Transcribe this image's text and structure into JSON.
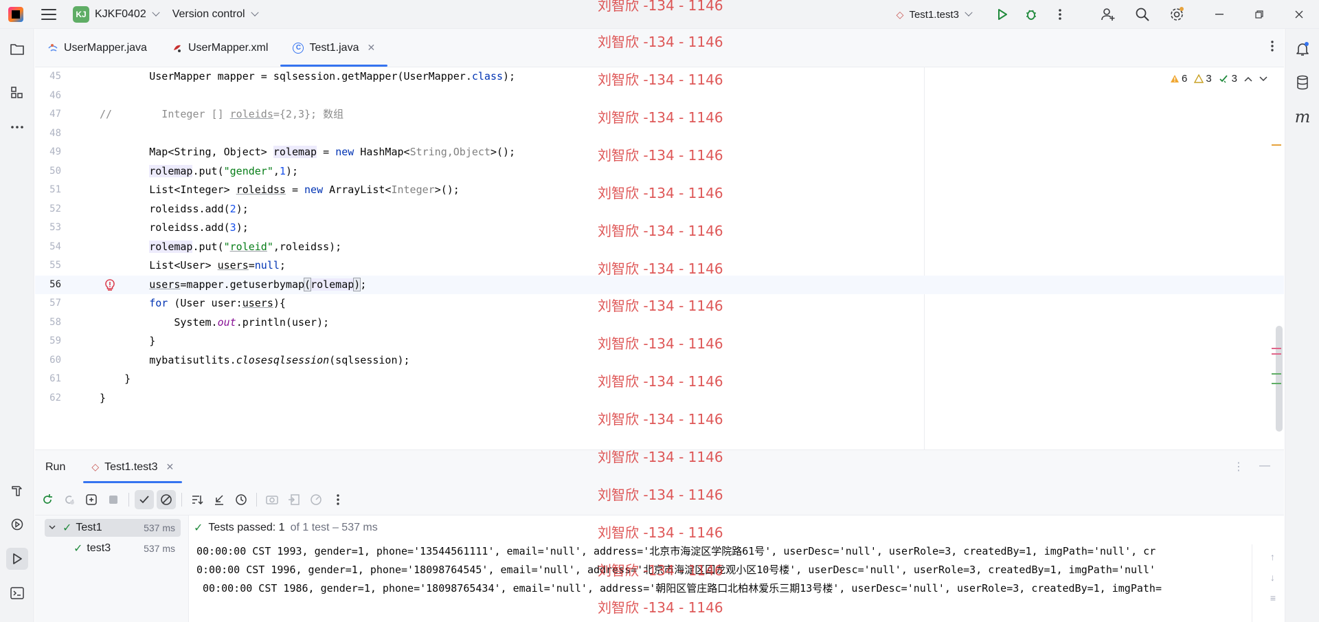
{
  "titlebar": {
    "project_badge": "KJ",
    "project_name": "KJKF0402",
    "vcs_label": "Version control",
    "run_config": "Test1.test3"
  },
  "editor_tabs": [
    {
      "label": "UserMapper.java",
      "active": false
    },
    {
      "label": "UserMapper.xml",
      "active": false
    },
    {
      "label": "Test1.java",
      "active": true
    }
  ],
  "inspections": {
    "warnings": "6",
    "weak_warnings": "3",
    "ok": "3"
  },
  "code_lines": [
    {
      "n": "45",
      "html": "        UserMapper mapper = sqlsession.getMapper(UserMapper.<span class=\"kw\">class</span>);"
    },
    {
      "n": "46",
      "html": ""
    },
    {
      "n": "47",
      "html": "<span class=\"cm\">//        Integer [] <span class=\"ul\">roleids</span>={2,3}; 数组</span>"
    },
    {
      "n": "48",
      "html": ""
    },
    {
      "n": "49",
      "html": "        Map&lt;String, Object&gt; <span class=\"hl\">rolemap</span> = <span class=\"kw\">new</span> HashMap&lt;<span class=\"gen\">String,Object</span>&gt;();"
    },
    {
      "n": "50",
      "html": "        <span class=\"hl\">rolemap</span>.put(<span class=\"str\">\"gender\"</span>,<span class=\"num\">1</span>);"
    },
    {
      "n": "51",
      "html": "        List&lt;Integer&gt; <span class=\"ul\">roleidss</span> = <span class=\"kw\">new</span> ArrayList&lt;<span class=\"gen\">Integer</span>&gt;();"
    },
    {
      "n": "52",
      "html": "        roleidss.add(<span class=\"num\">2</span>);"
    },
    {
      "n": "53",
      "html": "        roleidss.add(<span class=\"num\">3</span>);"
    },
    {
      "n": "54",
      "html": "        <span class=\"hl\">rolemap</span>.put(<span class=\"str\">\"<span class=\"ul\">roleid</span>\"</span>,roleidss);"
    },
    {
      "n": "55",
      "html": "        List&lt;User&gt; <span class=\"ul\">users</span>=<span class=\"kw\">null</span>;"
    },
    {
      "n": "56",
      "html": "        <span class=\"ul\">users</span>=mapper.getuserbymap<span class=\"bracket\">(</span><span class=\"hl\">rolemap</span><span class=\"bracket\">)</span>;",
      "current": true
    },
    {
      "n": "57",
      "html": "        <span class=\"kw\">for</span> (User user:<span class=\"ul\">users</span>){"
    },
    {
      "n": "58",
      "html": "            System.<span class=\"stat\">out</span>.println(user);"
    },
    {
      "n": "59",
      "html": "        }"
    },
    {
      "n": "60",
      "html": "        mybatisutlits.<span class=\"ital\">closesqlsession</span>(sqlsession);"
    },
    {
      "n": "61",
      "html": "    }"
    },
    {
      "n": "62",
      "html": "}"
    }
  ],
  "run": {
    "title": "Run",
    "tab_label": "Test1.test3",
    "status_passed": "Tests passed: 1",
    "status_detail": "of 1 test – 537 ms",
    "tree": [
      {
        "label": "Test1",
        "duration": "537 ms",
        "level": 0,
        "selected": true
      },
      {
        "label": "test3",
        "duration": "537 ms",
        "level": 1,
        "selected": false
      }
    ],
    "output": [
      "00:00:00 CST 1993, gender=1, phone='13544561111', email='null', address='北京市海淀区学院路61号', userDesc='null', userRole=3, createdBy=1, imgPath='null', cr",
      "0:00:00 CST 1996, gender=1, phone='18098764545', email='null', address='北京市海淀区回龙观小区10号楼', userDesc='null', userRole=3, createdBy=1, imgPath='null'",
      " 00:00:00 CST 1986, gender=1, phone='18098765434', email='null', address='朝阳区管庄路口北柏林爱乐三期13号楼', userDesc='null', userRole=3, createdBy=1, imgPath="
    ]
  },
  "watermark": "刘智欣 -134 - 1146",
  "colors": {
    "accent": "#3574f0",
    "pass": "#208a3c",
    "watermark": "#d93a3a"
  }
}
